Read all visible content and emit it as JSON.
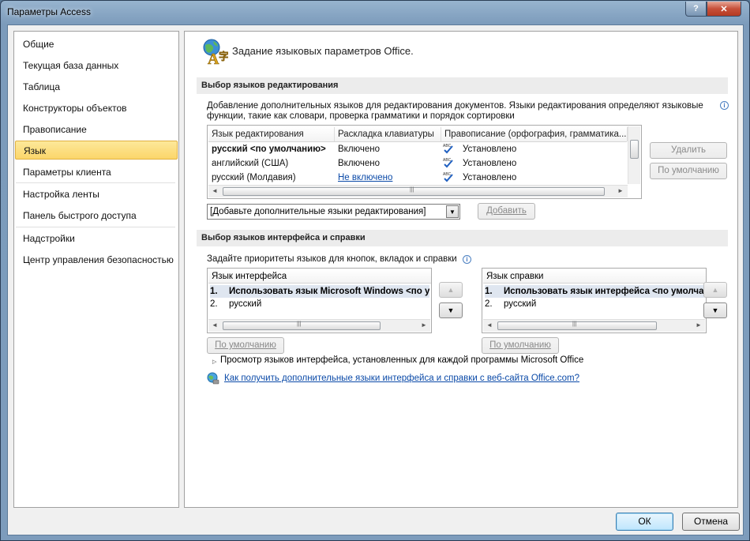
{
  "window": {
    "title": "Параметры Access",
    "help_glyph": "?",
    "close_glyph": "✕"
  },
  "nav": {
    "items": [
      {
        "label": "Общие",
        "selected": false
      },
      {
        "label": "Текущая база данных",
        "selected": false
      },
      {
        "label": "Таблица",
        "selected": false
      },
      {
        "label": "Конструкторы объектов",
        "selected": false
      },
      {
        "label": "Правописание",
        "selected": false
      },
      {
        "label": "Язык",
        "selected": true
      },
      {
        "label": "Параметры клиента",
        "selected": false
      },
      {
        "label": "Настройка ленты",
        "selected": false
      },
      {
        "label": "Панель быстрого доступа",
        "selected": false
      },
      {
        "label": "Надстройки",
        "selected": false
      },
      {
        "label": "Центр управления безопасностью",
        "selected": false
      }
    ]
  },
  "header": {
    "text": "Задание языковых параметров Office."
  },
  "editing": {
    "section_title": "Выбор языков редактирования",
    "description_line1": "Добавление дополнительных языков для редактирования документов. Языки редактирования определяют языковые",
    "description_line2": "функции, такие как словари, проверка грамматики и порядок сортировки",
    "columns": [
      "Язык редактирования",
      "Раскладка клавиатуры",
      "Правописание (орфография, грамматика..."
    ],
    "rows": [
      {
        "language": "русский <по умолчанию>",
        "keyboard": "Включено",
        "keyboard_link": false,
        "proofing": "Установлено",
        "bold": true
      },
      {
        "language": "английский (США)",
        "keyboard": "Включено",
        "keyboard_link": false,
        "proofing": "Установлено",
        "bold": false
      },
      {
        "language": "русский (Молдавия)",
        "keyboard": "Не включено",
        "keyboard_link": true,
        "proofing": "Установлено",
        "bold": false
      }
    ],
    "remove_button": "Удалить",
    "default_button": "По умолчанию",
    "add_combo_value": "[Добавьте дополнительные языки редактирования]",
    "add_button": "Добавить"
  },
  "ui": {
    "section_title": "Выбор языков интерфейса и справки",
    "description": "Задайте приоритеты языков для кнопок, вкладок и справки",
    "display_list": {
      "header": "Язык интерфейса",
      "items": [
        {
          "num": "1.",
          "label": "Использовать язык Microsoft Windows <по умолчанию>",
          "bold": true
        },
        {
          "num": "2.",
          "label": "русский",
          "bold": false
        }
      ],
      "default_button": "По умолчанию"
    },
    "help_list": {
      "header": "Язык справки",
      "items": [
        {
          "num": "1.",
          "label": "Использовать язык интерфейса <по умолчанию>",
          "bold": true
        },
        {
          "num": "2.",
          "label": "русский",
          "bold": false
        }
      ],
      "default_button": "По умолчанию"
    },
    "expander_text": "Просмотр языков интерфейса, установленных для каждой программы Microsoft Office",
    "link_text": "Как получить дополнительные языки интерфейса и справки с веб-сайта Office.com?"
  },
  "footer": {
    "ok": "ОК",
    "cancel": "Отмена"
  },
  "icons": {
    "up": "▲",
    "down": "▼",
    "left": "◄",
    "right": "►",
    "dropdown": "▼",
    "expand": "▷",
    "grip": "|||",
    "info": "i"
  }
}
